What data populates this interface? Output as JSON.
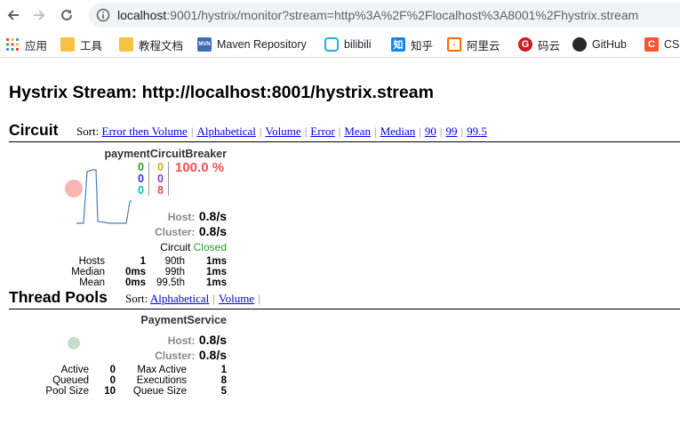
{
  "browser": {
    "url_host": "localhost",
    "url_rest": ":9001/hystrix/monitor?stream=http%3A%2F%2Flocalhost%3A8001%2Fhystrix.stream",
    "bookmarks": [
      {
        "label": "应用",
        "icon": "apps-grid-icon"
      },
      {
        "label": "工具",
        "icon": "folder-icon"
      },
      {
        "label": "教程文档",
        "icon": "folder-icon"
      },
      {
        "label": "Maven Repository",
        "icon": "maven-icon"
      },
      {
        "label": "bilibili",
        "icon": "bilibili-icon"
      },
      {
        "label": "知乎",
        "icon": "zhihu-icon"
      },
      {
        "label": "阿里云",
        "icon": "aliyun-icon"
      },
      {
        "label": "码云",
        "icon": "gitee-icon"
      },
      {
        "label": "GitHub",
        "icon": "github-icon"
      },
      {
        "label": "CS",
        "icon": "csdn-icon"
      }
    ]
  },
  "page": {
    "title": "Hystrix Stream: http://localhost:8001/hystrix.stream"
  },
  "circuit": {
    "section_title": "Circuit",
    "sort_label": "Sort:",
    "sort_links": [
      "Error then Volume",
      "Alphabetical",
      "Volume",
      "Error",
      "Mean",
      "Median",
      "90",
      "99",
      "99.5"
    ],
    "monitor": {
      "name": "paymentCircuitBreaker",
      "success": "0",
      "short_circuited": "0",
      "bad_request": "0",
      "timeout": "0",
      "rejected": "0",
      "failure": "8",
      "error_percentage": "100.0 %",
      "host_label": "Host:",
      "host_rate": "0.8/s",
      "cluster_label": "Cluster:",
      "cluster_rate": "0.8/s",
      "circuit_label": "Circuit",
      "circuit_status": "Closed",
      "stats": {
        "hosts_label": "Hosts",
        "hosts_value": "1",
        "median_label": "Median",
        "median_value": "0ms",
        "mean_label": "Mean",
        "mean_value": "0ms",
        "p90_label": "90th",
        "p90_value": "1ms",
        "p99_label": "99th",
        "p99_value": "1ms",
        "p995_label": "99.5th",
        "p995_value": "1ms"
      },
      "colors": {
        "success": "#2a9d2a",
        "short": "#3333cc",
        "bad": "#00c2a8",
        "timeout": "#e6a817",
        "rejected": "#9933cc",
        "failure": "#e05050",
        "circle": "#f9b4b4",
        "sparkline": "#4a7fb0"
      }
    }
  },
  "thread_pools": {
    "section_title": "Thread Pools",
    "sort_label": "Sort:",
    "sort_links": [
      "Alphabetical",
      "Volume"
    ],
    "monitor": {
      "name": "PaymentService",
      "host_label": "Host:",
      "host_rate": "0.8/s",
      "cluster_label": "Cluster:",
      "cluster_rate": "0.8/s",
      "stats": {
        "active_label": "Active",
        "active_value": "0",
        "queued_label": "Queued",
        "queued_value": "0",
        "pool_size_label": "Pool Size",
        "pool_size_value": "10",
        "max_active_label": "Max Active",
        "max_active_value": "1",
        "executions_label": "Executions",
        "executions_value": "8",
        "queue_size_label": "Queue Size",
        "queue_size_value": "5"
      },
      "colors": {
        "circle": "#c9dcc9"
      }
    }
  }
}
